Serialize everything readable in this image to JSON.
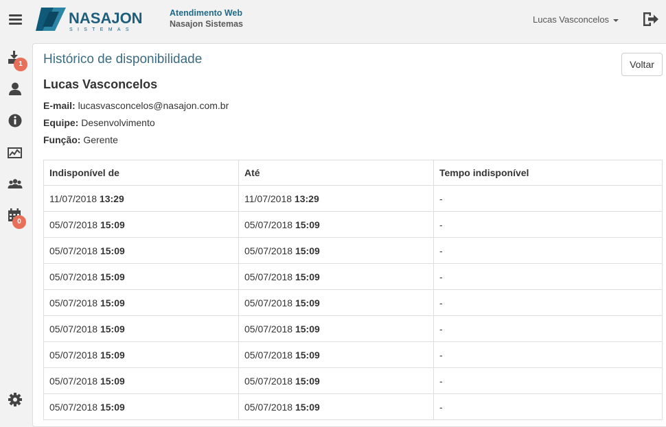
{
  "header": {
    "logo_text": "NASAJON",
    "logo_subtext": "SISTEMAS",
    "app_title": "Atendimento Web",
    "company": "Nasajon Sistemas",
    "user_name": "Lucas Vasconcelos",
    "icons": {
      "menu": "hamburger-icon",
      "logout": "logout-icon"
    }
  },
  "sidebar": {
    "items": [
      {
        "icon": "inbox-download-icon",
        "badge": "1"
      },
      {
        "icon": "user-icon",
        "badge": null
      },
      {
        "icon": "info-icon",
        "badge": null
      },
      {
        "icon": "chart-icon",
        "badge": null
      },
      {
        "icon": "group-icon",
        "badge": null
      },
      {
        "icon": "calendar-icon",
        "badge": "0"
      },
      {
        "icon": "gear-icon",
        "badge": null
      }
    ]
  },
  "page": {
    "title": "Histórico de disponibilidade",
    "back_label": "Voltar",
    "person": {
      "name": "Lucas Vasconcelos",
      "email_label": "E-mail:",
      "email": "lucasvasconcelos@nasajon.com.br",
      "team_label": "Equipe:",
      "team": "Desenvolvimento",
      "role_label": "Função:",
      "role": "Gerente"
    }
  },
  "table": {
    "headers": [
      "Indisponível de",
      "Até",
      "Tempo indisponível"
    ],
    "rows": [
      {
        "from_date": "11/07/2018",
        "from_time": "13:29",
        "to_date": "11/07/2018",
        "to_time": "13:29",
        "duration": "-"
      },
      {
        "from_date": "05/07/2018",
        "from_time": "15:09",
        "to_date": "05/07/2018",
        "to_time": "15:09",
        "duration": "-"
      },
      {
        "from_date": "05/07/2018",
        "from_time": "15:09",
        "to_date": "05/07/2018",
        "to_time": "15:09",
        "duration": "-"
      },
      {
        "from_date": "05/07/2018",
        "from_time": "15:09",
        "to_date": "05/07/2018",
        "to_time": "15:09",
        "duration": "-"
      },
      {
        "from_date": "05/07/2018",
        "from_time": "15:09",
        "to_date": "05/07/2018",
        "to_time": "15:09",
        "duration": "-"
      },
      {
        "from_date": "05/07/2018",
        "from_time": "15:09",
        "to_date": "05/07/2018",
        "to_time": "15:09",
        "duration": "-"
      },
      {
        "from_date": "05/07/2018",
        "from_time": "15:09",
        "to_date": "05/07/2018",
        "to_time": "15:09",
        "duration": "-"
      },
      {
        "from_date": "05/07/2018",
        "from_time": "15:09",
        "to_date": "05/07/2018",
        "to_time": "15:09",
        "duration": "-"
      },
      {
        "from_date": "05/07/2018",
        "from_time": "15:09",
        "to_date": "05/07/2018",
        "to_time": "15:09",
        "duration": "-"
      }
    ]
  },
  "colors": {
    "brand": "#1f6a8a",
    "title": "#3c6b80",
    "badge": "#e8705b",
    "background": "#f2f2f2"
  }
}
